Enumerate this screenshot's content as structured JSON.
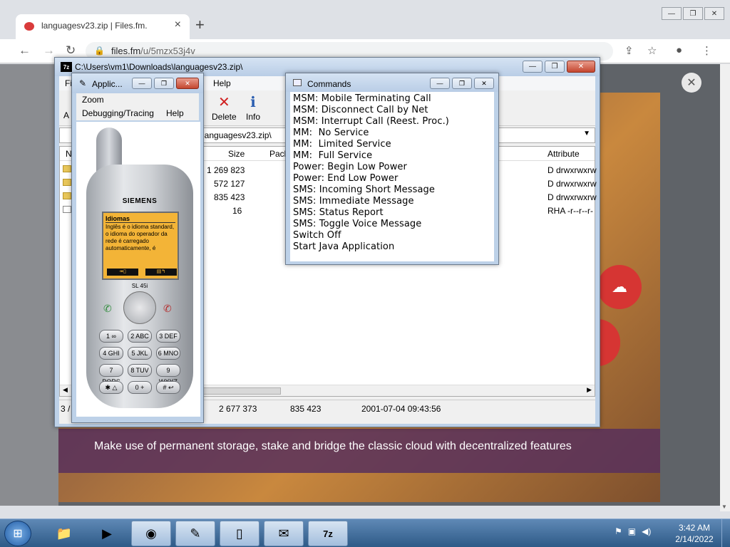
{
  "browser": {
    "tab_title": "languagesv23.zip | Files.fm.",
    "url_host": "files.fm",
    "url_path": "/u/5mzx53j4v",
    "banner_text": "Make use of permanent storage, stake and bridge the classic cloud with decentralized features"
  },
  "sevenzip": {
    "title": "C:\\Users\\vm1\\Downloads\\languagesv23.zip\\",
    "menu": [
      "Fi",
      "Help"
    ],
    "toolbar": [
      {
        "label": "Delete",
        "icon": "red-x-icon"
      },
      {
        "label": "Info",
        "icon": "info-icon"
      }
    ],
    "path_value": "languagesv23.zip\\",
    "columns": {
      "name": "N",
      "size": "Size",
      "packed": "Pack",
      "attributes": "Attribute"
    },
    "rows": [
      {
        "size": "1 269 823",
        "attributes": "D drwxrwxrw"
      },
      {
        "size": "572 127",
        "attributes": "D drwxrwxrw"
      },
      {
        "size": "835 423",
        "attributes": "D drwxrwxrw"
      },
      {
        "size": "16",
        "attributes": "RHA -r--r--r-"
      }
    ],
    "status": {
      "selection": "3 /",
      "total_size": "2 677 373",
      "selected_size": "835 423",
      "modified": "2001-07-04 09:43:56"
    },
    "toolbar_left_label": "A"
  },
  "appwin": {
    "title": "Applic...",
    "menu1": "Zoom",
    "menu2": [
      "Debugging/Tracing",
      "Help"
    ],
    "phone": {
      "brand": "SIEMENS",
      "model": "SL 45i",
      "screen_header": "Idiomas",
      "screen_text": "Inglês é o idioma standard, o idioma do operador da rede é carregado automaticamente, é",
      "keys": [
        "1 ∞",
        "2 ABC",
        "3 DEF",
        "4 GHI",
        "5 JKL",
        "6 MNO",
        "7 PQRS",
        "8 TUV",
        "9 WXYZ",
        "✱ △",
        "0 +",
        "# ↩"
      ]
    }
  },
  "commands": {
    "title": "Commands",
    "items": [
      "MSM: Mobile Terminating Call",
      "MSM: Disconnect Call by Net",
      "MSM: Interrupt Call (Reest. Proc.)",
      "MM:  No Service",
      "MM:  Limited Service",
      "MM:  Full Service",
      "Power: Begin Low Power",
      "Power: End Low Power",
      "SMS: Incoming Short Message",
      "SMS: Immediate Message",
      "SMS: Status Report",
      "SMS: Toggle Voice Message",
      "Switch Off",
      "Start Java Application"
    ]
  },
  "taskbar": {
    "time": "3:42 AM",
    "date": "2/14/2022"
  }
}
